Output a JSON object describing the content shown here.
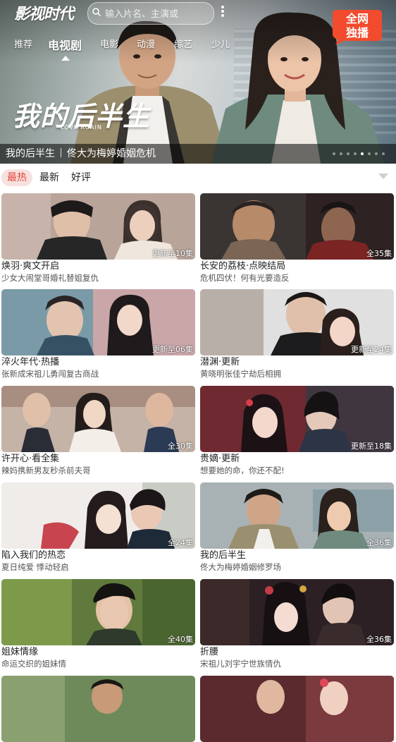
{
  "header": {
    "logo": "影视时代",
    "search_placeholder": "输入片名、主演或",
    "tabs": [
      {
        "label": "推荐"
      },
      {
        "label": "电视剧",
        "active": true
      },
      {
        "label": "电影"
      },
      {
        "label": "动漫"
      },
      {
        "label": "综艺"
      },
      {
        "label": "少儿"
      }
    ]
  },
  "banner": {
    "badge_line1": "全网",
    "badge_line2": "独播",
    "title_art": "我的后半生",
    "title_art_sub": "LOVE AGAIN",
    "caption_title": "我的后半生",
    "caption_desc": "佟大为梅婷婚姻危机",
    "slide_count": 8,
    "active_slide": 4
  },
  "sort": {
    "options": [
      "最热",
      "最新",
      "好评"
    ],
    "active": "最热"
  },
  "colors": {
    "accent": "#e2473a",
    "active_sort_bg": "#f7e1df",
    "badge": "#f24b2d"
  },
  "cards": [
    {
      "title": "焕羽·爽文开启",
      "desc": "少女大闹堂哥婚礼替姐复仇",
      "episodes": "更新至10集"
    },
    {
      "title": "长安的荔枝·点映结局",
      "desc": "危机四伏！何有光要造反",
      "episodes": "全35集"
    },
    {
      "title": "淬火年代·热播",
      "desc": "张新成宋祖儿勇闯复古商战",
      "episodes": "更新至06集"
    },
    {
      "title": "潜渊·更新",
      "desc": "黄晓明张佳宁劫后相拥",
      "episodes": "更新至24集"
    },
    {
      "title": "许开心·看全集",
      "desc": "辣妈携新男友秒杀前夫哥",
      "episodes": "全30集"
    },
    {
      "title": "贵嫡·更新",
      "desc": "想要她的命，你还不配!",
      "episodes": "更新至18集"
    },
    {
      "title": "陷入我们的热恋",
      "desc": "夏日纯爱 悸动轻启",
      "episodes": "全24集"
    },
    {
      "title": "我的后半生",
      "desc": "佟大为梅婷婚姻修罗场",
      "episodes": "全36集"
    },
    {
      "title": "姐妹情缘",
      "desc": "命运交织的姐妹情",
      "episodes": "全40集"
    },
    {
      "title": "折腰",
      "desc": "宋祖儿刘宇宁世族情仇",
      "episodes": "全36集"
    },
    {
      "title": "",
      "desc": "",
      "episodes": ""
    },
    {
      "title": "",
      "desc": "",
      "episodes": ""
    }
  ]
}
